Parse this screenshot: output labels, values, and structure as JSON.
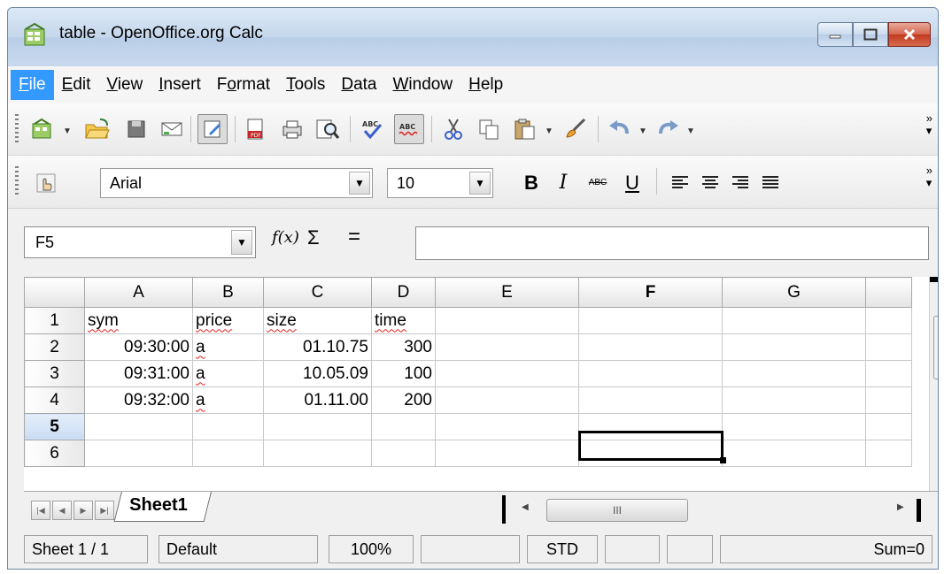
{
  "window": {
    "title": "table - OpenOffice.org Calc"
  },
  "menu": [
    {
      "label": "File",
      "accel": "F",
      "rest": "ile",
      "active": true
    },
    {
      "label": "Edit",
      "accel": "E",
      "rest": "dit"
    },
    {
      "label": "View",
      "accel": "V",
      "rest": "iew"
    },
    {
      "label": "Insert",
      "accel": "I",
      "rest": "nsert"
    },
    {
      "label": "Format",
      "accel_pre": "F",
      "accel": "o",
      "rest": "rmat"
    },
    {
      "label": "Tools",
      "accel": "T",
      "rest": "ools"
    },
    {
      "label": "Data",
      "accel": "D",
      "rest": "ata"
    },
    {
      "label": "Window",
      "accel": "W",
      "rest": "indow"
    },
    {
      "label": "Help",
      "accel": "H",
      "rest": "elp"
    }
  ],
  "formatting": {
    "font_name": "Arial",
    "font_size": "10",
    "bold_label": "B",
    "italic_label": "I",
    "strike_label": "ABC",
    "underline_label": "U"
  },
  "formula_bar": {
    "name_box": "F5",
    "fx_label": "f(x)",
    "sigma_label": "Σ",
    "equals_label": "=",
    "content": ""
  },
  "grid": {
    "columns": [
      "A",
      "B",
      "C",
      "D",
      "E",
      "F",
      "G"
    ],
    "rows": [
      {
        "num": "1",
        "cells": [
          "sym",
          "price",
          "size",
          "time",
          "",
          "",
          ""
        ]
      },
      {
        "num": "2",
        "cells": [
          "09:30:00",
          "a",
          "01.10.75",
          "300",
          "",
          "",
          ""
        ]
      },
      {
        "num": "3",
        "cells": [
          "09:31:00",
          "a",
          "10.05.09",
          "100",
          "",
          "",
          ""
        ]
      },
      {
        "num": "4",
        "cells": [
          "09:32:00",
          "a",
          "01.11.00",
          "200",
          "",
          "",
          ""
        ]
      },
      {
        "num": "5",
        "cells": [
          "",
          "",
          "",
          "",
          "",
          "",
          ""
        ]
      },
      {
        "num": "6",
        "cells": [
          "",
          "",
          "",
          "",
          "",
          "",
          ""
        ]
      }
    ],
    "selected_cell": "F5"
  },
  "sheet_tabs": {
    "active": "Sheet1"
  },
  "status": {
    "sheet": "Sheet 1 / 1",
    "page_style": "Default",
    "zoom": "100%",
    "mode": "STD",
    "sum": "Sum=0"
  },
  "icons": {
    "hscroll_grip": "III",
    "vscroll_grip": "≡"
  }
}
